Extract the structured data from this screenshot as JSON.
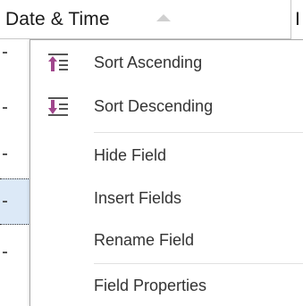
{
  "column_header": {
    "title": "Date & Time",
    "next_column_fragment": "I"
  },
  "context_menu": {
    "items": [
      {
        "label": "Sort Ascending",
        "icon": "sort-ascending-icon"
      },
      {
        "label": "Sort Descending",
        "icon": "sort-descending-icon"
      },
      {
        "label": "Hide Field",
        "icon": ""
      },
      {
        "label": "Insert Fields",
        "icon": ""
      },
      {
        "label": "Rename Field",
        "icon": ""
      },
      {
        "label": "Field Properties",
        "icon": ""
      }
    ]
  },
  "colors": {
    "sort_icon_accent": "#a0468c",
    "sort_icon_lines": "#555555",
    "selected_row_bg": "#dce9f7"
  }
}
